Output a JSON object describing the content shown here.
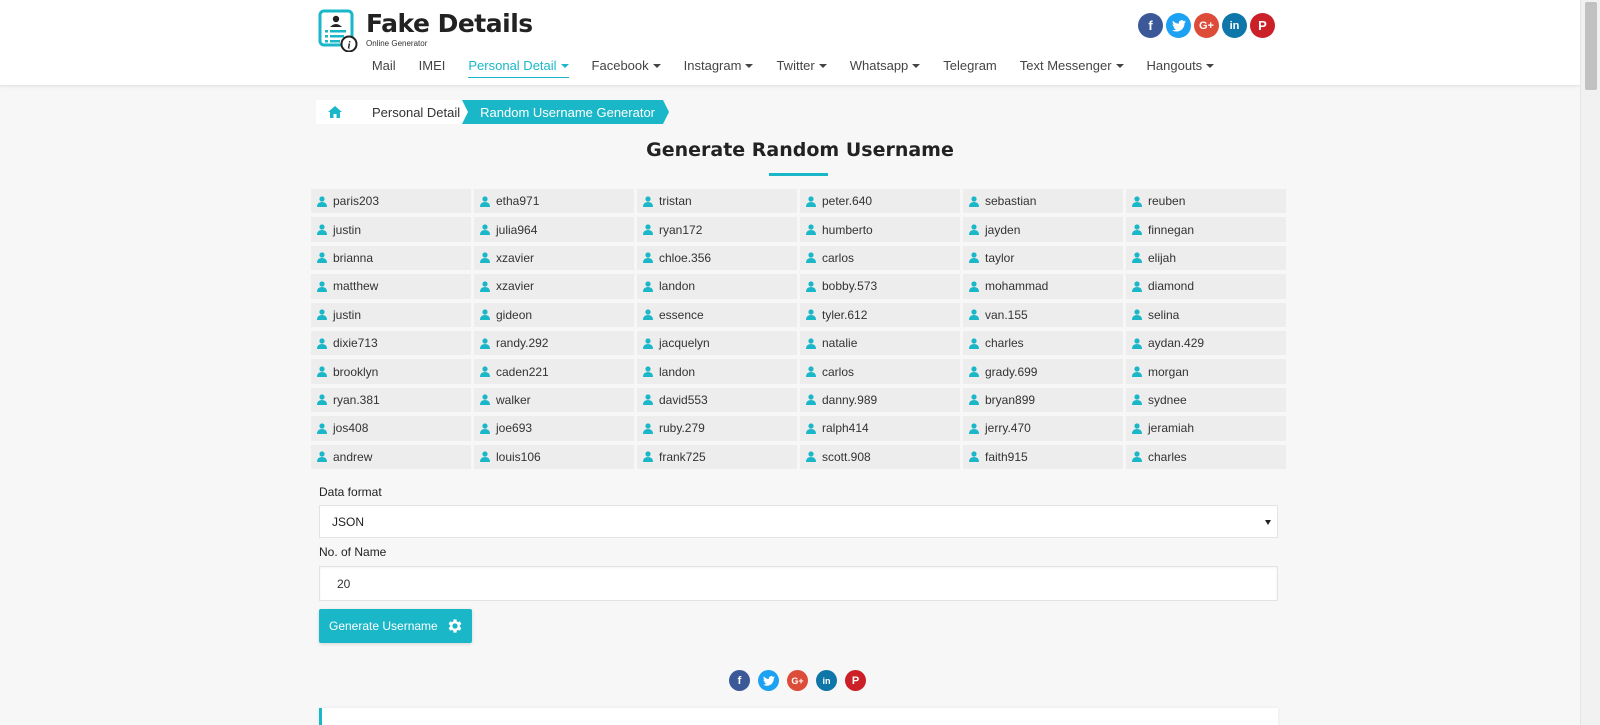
{
  "brand": {
    "title": "Fake Details",
    "subtitle": "Online Generator"
  },
  "social": [
    "f",
    "t",
    "G+",
    "in",
    "P"
  ],
  "nav": [
    {
      "label": "Mail",
      "dropdown": false,
      "active": false
    },
    {
      "label": "IMEI",
      "dropdown": false,
      "active": false
    },
    {
      "label": "Personal Detail",
      "dropdown": true,
      "active": true
    },
    {
      "label": "Facebook",
      "dropdown": true,
      "active": false
    },
    {
      "label": "Instagram",
      "dropdown": true,
      "active": false
    },
    {
      "label": "Twitter",
      "dropdown": true,
      "active": false
    },
    {
      "label": "Whatsapp",
      "dropdown": true,
      "active": false
    },
    {
      "label": "Telegram",
      "dropdown": false,
      "active": false
    },
    {
      "label": "Text Messenger",
      "dropdown": true,
      "active": true
    },
    {
      "label": "Hangouts",
      "dropdown": true,
      "active": false
    }
  ],
  "breadcrumb": {
    "parent": "Personal Detail",
    "current": "Random Username Generator"
  },
  "page_title": "Generate Random Username",
  "usernames": [
    "paris203",
    "etha971",
    "tristan",
    "peter.640",
    "sebastian",
    "reuben",
    "justin",
    "julia964",
    "ryan172",
    "humberto",
    "jayden",
    "finnegan",
    "brianna",
    "xzavier",
    "chloe.356",
    "carlos",
    "taylor",
    "elijah",
    "matthew",
    "xzavier",
    "landon",
    "bobby.573",
    "mohammad",
    "diamond",
    "justin",
    "gideon",
    "essence",
    "tyler.612",
    "van.155",
    "selina",
    "dixie713",
    "randy.292",
    "jacquelyn",
    "natalie",
    "charles",
    "aydan.429",
    "brooklyn",
    "caden221",
    "landon",
    "carlos",
    "grady.699",
    "morgan",
    "ryan.381",
    "walker",
    "david553",
    "danny.989",
    "bryan899",
    "sydnee",
    "jos408",
    "joe693",
    "ruby.279",
    "ralph414",
    "jerry.470",
    "jeramiah",
    "andrew",
    "louis106",
    "frank725",
    "scott.908",
    "faith915",
    "charles"
  ],
  "form": {
    "format_label": "Data format",
    "format_value": "JSON",
    "count_label": "No. of Name",
    "count_value": "20",
    "button_label": "Generate Username"
  },
  "colors": {
    "accent": "#1ab7c8"
  }
}
